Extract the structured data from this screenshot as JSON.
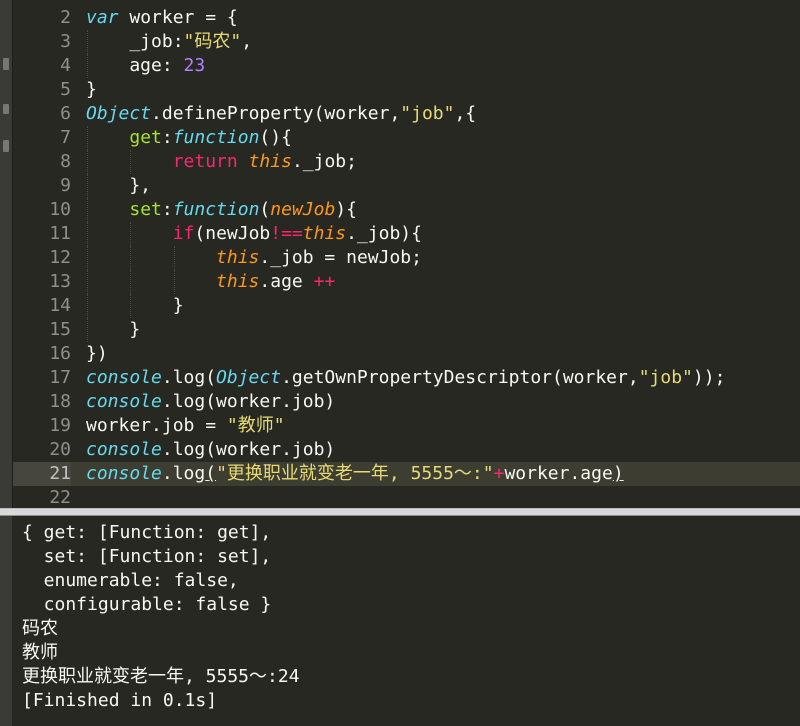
{
  "editor": {
    "current_line": "21",
    "lines": [
      {
        "num": "2",
        "indent": 0,
        "tokens": [
          {
            "t": "var",
            "c": "t-storage"
          },
          {
            "t": " worker = {",
            "c": "t-plain"
          }
        ]
      },
      {
        "num": "3",
        "indent": 1,
        "tokens": [
          {
            "t": "    _job:",
            "c": "t-plain"
          },
          {
            "t": "\"码农\"",
            "c": "t-string"
          },
          {
            "t": ",",
            "c": "t-plain"
          }
        ]
      },
      {
        "num": "4",
        "indent": 1,
        "tokens": [
          {
            "t": "    age: ",
            "c": "t-plain"
          },
          {
            "t": "23",
            "c": "t-number"
          }
        ]
      },
      {
        "num": "5",
        "indent": 0,
        "tokens": [
          {
            "t": "}",
            "c": "t-plain"
          }
        ]
      },
      {
        "num": "6",
        "indent": 0,
        "tokens": [
          {
            "t": "Object",
            "c": "t-support"
          },
          {
            "t": ".defineProperty(worker,",
            "c": "t-plain"
          },
          {
            "t": "\"job\"",
            "c": "t-string"
          },
          {
            "t": ",{",
            "c": "t-plain"
          }
        ]
      },
      {
        "num": "7",
        "indent": 1,
        "tokens": [
          {
            "t": "    ",
            "c": "t-plain"
          },
          {
            "t": "get",
            "c": "t-func"
          },
          {
            "t": ":",
            "c": "t-plain"
          },
          {
            "t": "function",
            "c": "t-storage"
          },
          {
            "t": "(){",
            "c": "t-plain"
          }
        ]
      },
      {
        "num": "8",
        "indent": 2,
        "tokens": [
          {
            "t": "        ",
            "c": "t-plain"
          },
          {
            "t": "return",
            "c": "t-keyword"
          },
          {
            "t": " ",
            "c": "t-plain"
          },
          {
            "t": "this",
            "c": "t-this"
          },
          {
            "t": "._job;",
            "c": "t-plain"
          }
        ]
      },
      {
        "num": "9",
        "indent": 1,
        "tokens": [
          {
            "t": "    },",
            "c": "t-plain"
          }
        ]
      },
      {
        "num": "10",
        "indent": 1,
        "tokens": [
          {
            "t": "    ",
            "c": "t-plain"
          },
          {
            "t": "set",
            "c": "t-func"
          },
          {
            "t": ":",
            "c": "t-plain"
          },
          {
            "t": "function",
            "c": "t-storage"
          },
          {
            "t": "(",
            "c": "t-plain"
          },
          {
            "t": "newJob",
            "c": "t-param"
          },
          {
            "t": "){",
            "c": "t-plain"
          }
        ]
      },
      {
        "num": "11",
        "indent": 2,
        "tokens": [
          {
            "t": "        ",
            "c": "t-plain"
          },
          {
            "t": "if",
            "c": "t-keyword"
          },
          {
            "t": "(newJob",
            "c": "t-plain"
          },
          {
            "t": "!==",
            "c": "t-keyword"
          },
          {
            "t": "this",
            "c": "t-this"
          },
          {
            "t": "._job){",
            "c": "t-plain"
          }
        ]
      },
      {
        "num": "12",
        "indent": 3,
        "tokens": [
          {
            "t": "            ",
            "c": "t-plain"
          },
          {
            "t": "this",
            "c": "t-this"
          },
          {
            "t": "._job = newJob;",
            "c": "t-plain"
          }
        ]
      },
      {
        "num": "13",
        "indent": 3,
        "tokens": [
          {
            "t": "            ",
            "c": "t-plain"
          },
          {
            "t": "this",
            "c": "t-this"
          },
          {
            "t": ".age ",
            "c": "t-plain"
          },
          {
            "t": "++",
            "c": "t-keyword"
          }
        ]
      },
      {
        "num": "14",
        "indent": 2,
        "tokens": [
          {
            "t": "        }",
            "c": "t-plain"
          }
        ]
      },
      {
        "num": "15",
        "indent": 1,
        "tokens": [
          {
            "t": "    }",
            "c": "t-plain"
          }
        ]
      },
      {
        "num": "16",
        "indent": 0,
        "tokens": [
          {
            "t": "})",
            "c": "t-plain"
          }
        ]
      },
      {
        "num": "17",
        "indent": 0,
        "tokens": [
          {
            "t": "console",
            "c": "t-support"
          },
          {
            "t": ".log(",
            "c": "t-plain"
          },
          {
            "t": "Object",
            "c": "t-support"
          },
          {
            "t": ".getOwnPropertyDescriptor(worker,",
            "c": "t-plain"
          },
          {
            "t": "\"job\"",
            "c": "t-string"
          },
          {
            "t": "));",
            "c": "t-plain"
          }
        ]
      },
      {
        "num": "18",
        "indent": 0,
        "tokens": [
          {
            "t": "console",
            "c": "t-support"
          },
          {
            "t": ".log(worker.job)",
            "c": "t-plain"
          }
        ]
      },
      {
        "num": "19",
        "indent": 0,
        "tokens": [
          {
            "t": "worker.job = ",
            "c": "t-plain"
          },
          {
            "t": "\"教师\"",
            "c": "t-string"
          }
        ]
      },
      {
        "num": "20",
        "indent": 0,
        "tokens": [
          {
            "t": "console",
            "c": "t-support"
          },
          {
            "t": ".log(worker.job)",
            "c": "t-plain"
          }
        ]
      },
      {
        "num": "21",
        "indent": 0,
        "tokens": [
          {
            "t": "console",
            "c": "t-support"
          },
          {
            "t": ".log",
            "c": "t-plain"
          },
          {
            "t": "(",
            "c": "t-plain t-underline"
          },
          {
            "t": "\"更换职业就变老一年, 5555～:\"",
            "c": "t-string"
          },
          {
            "t": "+",
            "c": "t-keyword"
          },
          {
            "t": "worker.age",
            "c": "t-plain"
          },
          {
            "t": ")",
            "c": "t-plain t-underline"
          }
        ]
      },
      {
        "num": "22",
        "indent": 0,
        "tokens": []
      }
    ]
  },
  "console": {
    "lines": [
      "{ get: [Function: get],",
      "  set: [Function: set],",
      "  enumerable: false,",
      "  configurable: false }",
      "码农",
      "教师",
      "更换职业就变老一年, 5555～:24",
      "[Finished in 0.1s]"
    ]
  },
  "colors": {
    "background": "#272822",
    "string": "#e6db74",
    "keyword": "#f92672",
    "storage": "#66d9ef",
    "function": "#a6e22e",
    "number": "#ae81ff",
    "this": "#fd971f"
  }
}
